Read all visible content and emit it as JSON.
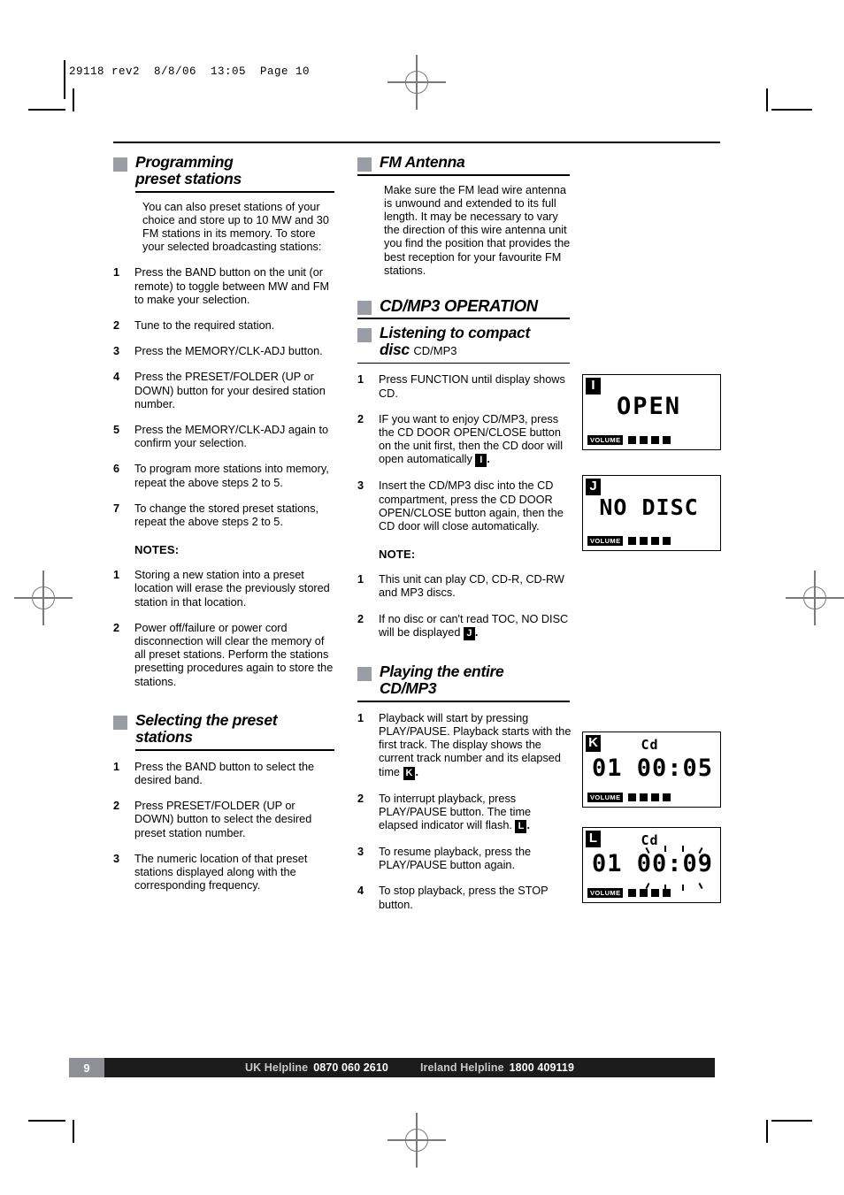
{
  "slug": "29118 rev2  8/8/06  13:05  Page 10",
  "left_column": {
    "section1": {
      "heading_line1": "Programming",
      "heading_line2": "preset stations",
      "intro": "You can also preset stations of your choice and store up to 10 MW and 30 FM stations in its memory. To store your selected broadcasting stations:",
      "steps": [
        {
          "num": "1",
          "text": "Press the BAND button on the unit (or remote) to toggle between MW and FM to make your selection."
        },
        {
          "num": "2",
          "text": "Tune to the required station."
        },
        {
          "num": "3",
          "text": "Press the MEMORY/CLK-ADJ button."
        },
        {
          "num": "4",
          "text": "Press the PRESET/FOLDER (UP or DOWN) button for your desired station number."
        },
        {
          "num": "5",
          "text": "Press the MEMORY/CLK-ADJ again to confirm your selection."
        },
        {
          "num": "6",
          "text": "To program more stations into memory, repeat the above steps 2 to 5."
        },
        {
          "num": "7",
          "text": "To change the stored preset stations, repeat the above steps 2 to 5."
        }
      ],
      "notes_label": "NOTES:",
      "notes": [
        {
          "num": "1",
          "text": "Storing a new station into a preset location will erase the previously stored station in that location."
        },
        {
          "num": "2",
          "text": "Power off/failure or power cord disconnection will clear the memory of all preset stations. Perform the stations presetting procedures again to store the stations."
        }
      ]
    },
    "section2": {
      "heading_line1": "Selecting the preset",
      "heading_line2": "stations",
      "steps": [
        {
          "num": "1",
          "text": "Press the BAND button to select the desired band."
        },
        {
          "num": "2",
          "text": "Press PRESET/FOLDER (UP or DOWN) button to select the desired preset station number."
        },
        {
          "num": "3",
          "text": "The numeric location of that preset stations displayed along with the corresponding frequency."
        }
      ]
    }
  },
  "right_column": {
    "fm_antenna": {
      "heading": "FM Antenna",
      "body": "Make sure the FM lead wire antenna is unwound and extended to its full length. It may be necessary to vary the direction of this wire antenna unit you find the position that provides the best reception for your favourite FM stations."
    },
    "cd_operation_heading": "CD/MP3 OPERATION",
    "listening": {
      "heading_line1": "Listening to compact",
      "heading_line2": "disc",
      "heading_sub": "CD/MP3",
      "steps": [
        {
          "num": "1",
          "text": "Press FUNCTION until display shows CD.",
          "ref": ""
        },
        {
          "num": "2",
          "text_before": "IF you want to enjoy CD/MP3, press the CD DOOR OPEN/CLOSE  button on the unit first, then the CD door will open automatically ",
          "ref": "I",
          "text_after": "."
        },
        {
          "num": "3",
          "text": "Insert the CD/MP3 disc into the CD compartment, press the CD DOOR OPEN/CLOSE button again, then the CD door will close automatically.",
          "ref": ""
        }
      ],
      "note_label": "NOTE:",
      "notes": [
        {
          "num": "1",
          "text_before": "This unit can play CD, CD-R, CD-RW and MP3 discs.",
          "ref": "",
          "text_after": ""
        },
        {
          "num": "2",
          "text_before": "If no disc or can't read TOC, NO DISC will be displayed ",
          "ref": "J",
          "text_after": "."
        }
      ]
    },
    "playing": {
      "heading_line1": "Playing the entire",
      "heading_line2": "CD/MP3",
      "steps": [
        {
          "num": "1",
          "text_before": "Playback will start by pressing PLAY/PAUSE. Playback starts with the first track. The display shows the current track number and its elapsed time ",
          "ref": "K",
          "text_after": "."
        },
        {
          "num": "2",
          "text_before": "To interrupt playback, press PLAY/PAUSE button. The time elapsed indicator will flash. ",
          "ref": "L",
          "text_after": "."
        },
        {
          "num": "3",
          "text_before": "To resume playback, press the PLAY/PAUSE button again.",
          "ref": "",
          "text_after": ""
        },
        {
          "num": "4",
          "text_before": "To stop playback, press the STOP button.",
          "ref": "",
          "text_after": ""
        }
      ]
    }
  },
  "lcd_panels": [
    {
      "tag": "I",
      "mode": "word",
      "word": "OPEN",
      "volume_label": "VOLUME",
      "bars": 4,
      "flash": false
    },
    {
      "tag": "J",
      "mode": "word",
      "word": "NO DISC",
      "volume_label": "VOLUME",
      "bars": 4,
      "flash": false
    },
    {
      "tag": "K",
      "mode": "track",
      "source": "Cd",
      "track": "01",
      "time": "00:05",
      "volume_label": "VOLUME",
      "bars": 4,
      "flash": false
    },
    {
      "tag": "L",
      "mode": "track",
      "source": "Cd",
      "track": "01",
      "time": "00:09",
      "volume_label": "VOLUME",
      "bars": 4,
      "flash": true
    }
  ],
  "footer": {
    "page_number": "9",
    "uk_label": "UK Helpline",
    "uk_number": "0870 060 2610",
    "ireland_label": "Ireland Helpline",
    "ireland_number": "1800 409119"
  },
  "colors": {
    "heading_square": "#9a9da3",
    "footer_bar": "#1b1b1b",
    "footer_pageno": "#8e9096"
  }
}
